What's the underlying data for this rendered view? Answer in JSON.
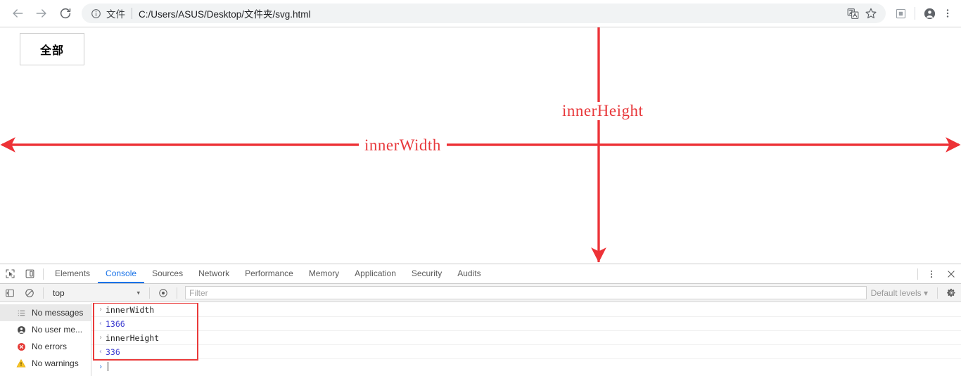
{
  "browser": {
    "back_icon": "arrow-left-icon",
    "forward_icon": "arrow-right-icon",
    "reload_icon": "reload-icon",
    "omnibox": {
      "info_icon": "info-circle-icon",
      "file_label": "文件",
      "url": "C:/Users/ASUS/Desktop/文件夹/svg.html"
    },
    "actions": {
      "translate_icon": "translate-icon",
      "bookmark_icon": "star-icon",
      "cast_icon": "cast-square-icon",
      "profile_icon": "person-avatar-icon",
      "menu_icon": "three-dot-menu-icon"
    }
  },
  "page": {
    "all_button_label": "全部",
    "annotations": {
      "inner_height_label": "innerHeight",
      "inner_width_label": "innerWidth",
      "arrow_color": "#ed3237"
    }
  },
  "devtools": {
    "inspect_icon": "inspect-element-icon",
    "device_toolbar_icon": "device-toolbar-icon",
    "tabs": [
      {
        "label": "Elements",
        "active": false
      },
      {
        "label": "Console",
        "active": true
      },
      {
        "label": "Sources",
        "active": false
      },
      {
        "label": "Network",
        "active": false
      },
      {
        "label": "Performance",
        "active": false
      },
      {
        "label": "Memory",
        "active": false
      },
      {
        "label": "Application",
        "active": false
      },
      {
        "label": "Security",
        "active": false
      },
      {
        "label": "Audits",
        "active": false
      }
    ],
    "more_icon": "three-dot-menu-icon",
    "close_icon": "close-x-icon",
    "filterbar": {
      "sidebar_toggle_icon": "console-sidebar-toggle-icon",
      "clear_console_icon": "clear-console-ban-icon",
      "context_value": "top",
      "context_caret": "▾",
      "eye_icon": "live-expression-eye-icon",
      "filter_placeholder": "Filter",
      "levels_value": "Default levels",
      "levels_caret": "▾",
      "settings_icon": "gear-icon"
    },
    "sidebar": [
      {
        "icon": "list-messages-icon",
        "label": "No messages",
        "selected": true
      },
      {
        "icon": "person-avatar-icon",
        "label": "No user me...",
        "selected": false
      },
      {
        "icon": "error-circle-icon",
        "label": "No errors",
        "selected": false
      },
      {
        "icon": "warning-triangle-icon",
        "label": "No warnings",
        "selected": false
      }
    ],
    "console_rows": [
      {
        "marker": "›",
        "type": "input",
        "text": "innerWidth"
      },
      {
        "marker": "‹",
        "type": "output",
        "text": "1366"
      },
      {
        "marker": "›",
        "type": "input",
        "text": "innerHeight"
      },
      {
        "marker": "‹",
        "type": "output",
        "text": "336"
      }
    ],
    "prompt_caret": "›"
  }
}
